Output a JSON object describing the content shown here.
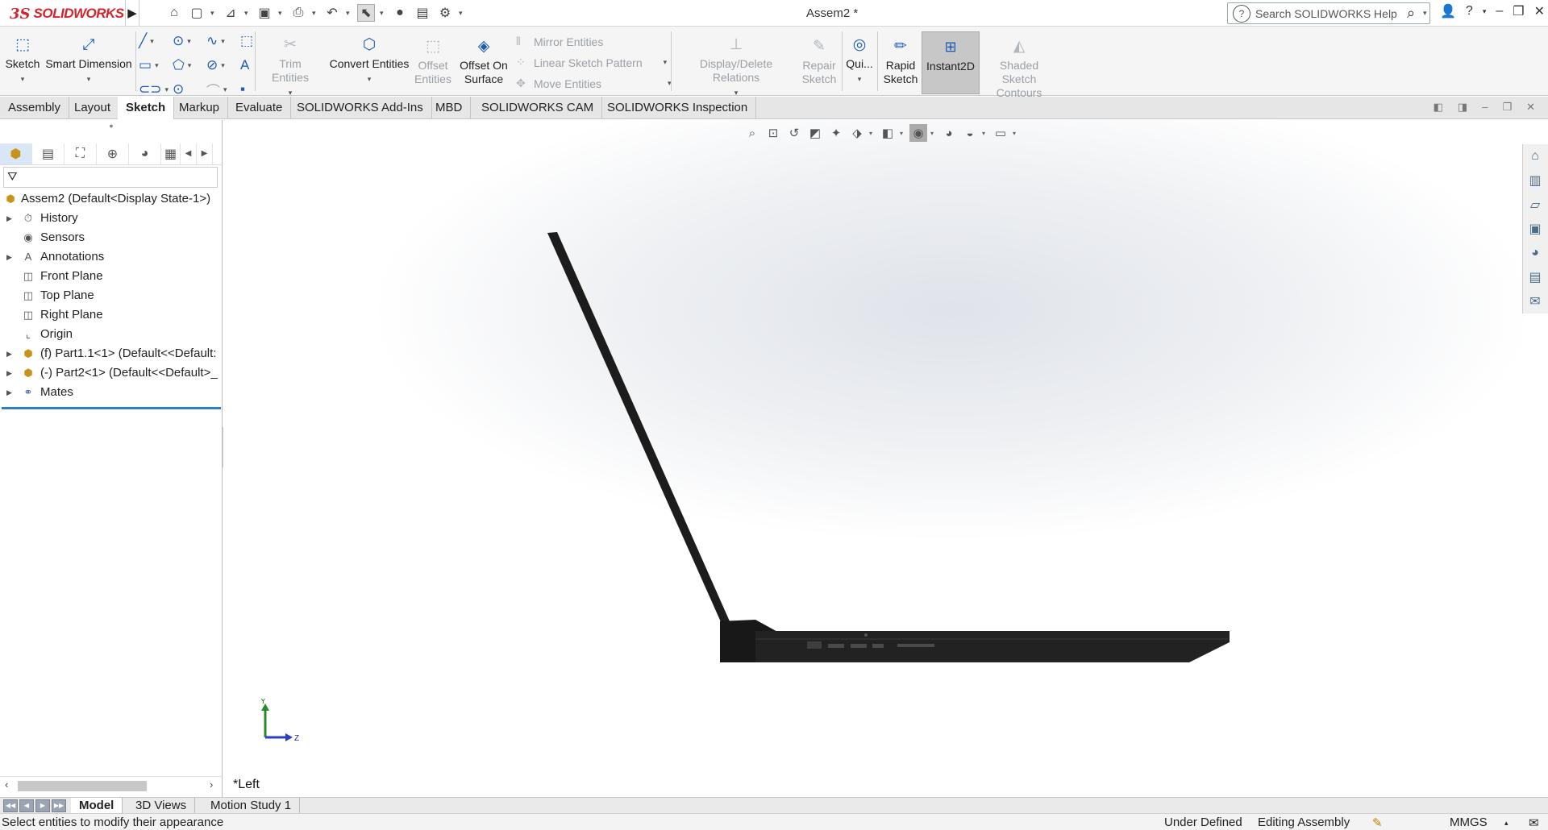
{
  "app": {
    "logo_prefix": "3S",
    "logo_name": "SOLIDWORKS",
    "document_title": "Assem2 *",
    "search_placeholder": "Search SOLIDWORKS Help"
  },
  "ribbon": {
    "sketch": "Sketch",
    "smart_dimension": "Smart Dimension",
    "trim_entities": "Trim Entities",
    "convert_entities": "Convert Entities",
    "offset_entities_1": "Offset",
    "offset_entities_2": "Entities",
    "offset_on_surface_1": "Offset On",
    "offset_on_surface_2": "Surface",
    "mirror_entities": "Mirror Entities",
    "linear_sketch_pattern": "Linear Sketch Pattern",
    "move_entities": "Move Entities",
    "display_delete_relations": "Display/Delete Relations",
    "repair_sketch_1": "Repair",
    "repair_sketch_2": "Sketch",
    "quick_snaps": "Qui...",
    "rapid_sketch_1": "Rapid",
    "rapid_sketch_2": "Sketch",
    "instant2d": "Instant2D",
    "shaded_contours_1": "Shaded Sketch",
    "shaded_contours_2": "Contours"
  },
  "tabs": [
    "Assembly",
    "Layout",
    "Sketch",
    "Markup",
    "Evaluate",
    "SOLIDWORKS Add-Ins",
    "MBD",
    "SOLIDWORKS CAM",
    "SOLIDWORKS Inspection"
  ],
  "active_tab": "Sketch",
  "tree": {
    "root": "Assem2  (Default<Display State-1>)",
    "items": [
      {
        "label": "History",
        "expandable": true,
        "icon": "history-icon"
      },
      {
        "label": "Sensors",
        "expandable": false,
        "icon": "sensors-icon"
      },
      {
        "label": "Annotations",
        "expandable": true,
        "icon": "annotations-icon"
      },
      {
        "label": "Front Plane",
        "expandable": false,
        "icon": "plane-icon"
      },
      {
        "label": "Top Plane",
        "expandable": false,
        "icon": "plane-icon"
      },
      {
        "label": "Right Plane",
        "expandable": false,
        "icon": "plane-icon"
      },
      {
        "label": "Origin",
        "expandable": false,
        "icon": "origin-icon"
      },
      {
        "label": "(f) Part1.1<1> (Default<<Default:",
        "expandable": true,
        "icon": "part-icon"
      },
      {
        "label": "(-) Part2<1> (Default<<Default>_",
        "expandable": true,
        "icon": "part-icon"
      },
      {
        "label": "Mates",
        "expandable": true,
        "icon": "mates-icon"
      }
    ]
  },
  "viewport": {
    "view_name": "*Left",
    "triad_y": "Y",
    "triad_z": "Z"
  },
  "bottom_tabs": [
    "Model",
    "3D Views",
    "Motion Study 1"
  ],
  "active_bottom_tab": "Model",
  "status": {
    "message": "Select entities to modify their appearance",
    "definition": "Under Defined",
    "mode": "Editing Assembly",
    "units": "MMGS"
  }
}
